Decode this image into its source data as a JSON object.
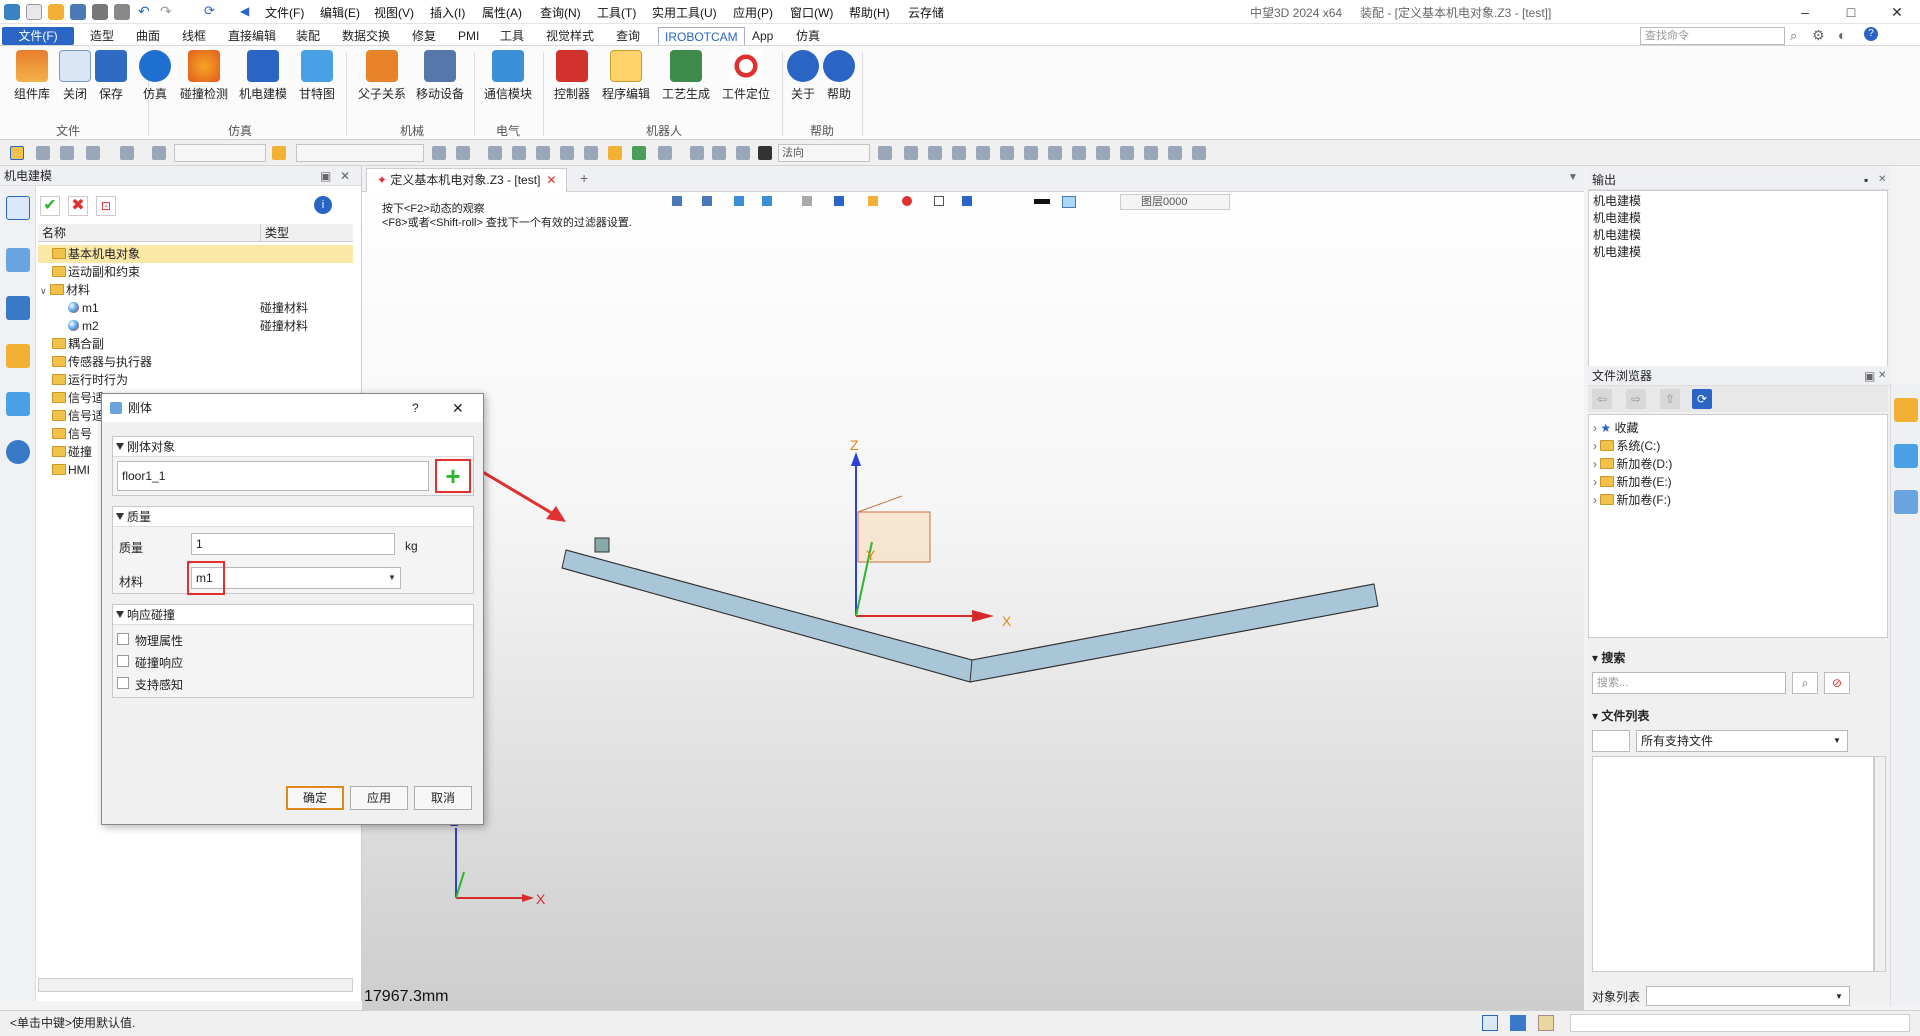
{
  "titlebar": {
    "menus": [
      "文件(F)",
      "编辑(E)",
      "视图(V)",
      "插入(I)",
      "属性(A)",
      "查询(N)",
      "工具(T)",
      "实用工具(U)",
      "应用(P)",
      "窗口(W)",
      "帮助(H)",
      "云存储"
    ],
    "app_name": "中望3D 2024 x64",
    "doc_title": "装配 - [定义基本机电对象.Z3 - [test]]",
    "search_placeholder": "查找命令"
  },
  "ribbon": {
    "tabs": [
      "文件(F)",
      "造型",
      "曲面",
      "线框",
      "直接编辑",
      "装配",
      "数据交换",
      "修复",
      "PMI",
      "工具",
      "视觉样式",
      "查询",
      "IROBOTCAM",
      "App",
      "仿真"
    ],
    "active_tab": "IROBOTCAM",
    "buttons": [
      "组件库",
      "关闭",
      "保存",
      "仿真",
      "碰撞检测",
      "机电建模",
      "甘特图",
      "父子关系",
      "移动设备",
      "通信模块",
      "控制器",
      "程序编辑",
      "工艺生成",
      "工件定位",
      "关于",
      "帮助"
    ],
    "groups": [
      "文件",
      "仿真",
      "机械",
      "电气",
      "机器人",
      "帮助"
    ]
  },
  "toolbar2": {
    "combo_filter": "法向"
  },
  "left_panel": {
    "title": "机电建模",
    "columns": [
      "名称",
      "类型"
    ],
    "tree": [
      {
        "name": "基本机电对象",
        "type": "",
        "kind": "folder",
        "selected": true
      },
      {
        "name": "运动副和约束",
        "type": "",
        "kind": "folder"
      },
      {
        "name": "材料",
        "type": "",
        "kind": "folder",
        "expanded": true
      },
      {
        "name": "m1",
        "type": "碰撞材料",
        "kind": "material"
      },
      {
        "name": "m2",
        "type": "碰撞材料",
        "kind": "material"
      },
      {
        "name": "耦合副",
        "type": "",
        "kind": "folder"
      },
      {
        "name": "传感器与执行器",
        "type": "",
        "kind": "folder"
      },
      {
        "name": "运行时行为",
        "type": "",
        "kind": "folder"
      },
      {
        "name": "信号适",
        "type": "",
        "kind": "folder"
      },
      {
        "name": "信号适",
        "type": "",
        "kind": "folder"
      },
      {
        "name": "信号",
        "type": "",
        "kind": "folder"
      },
      {
        "name": "碰撞",
        "type": "",
        "kind": "folder"
      },
      {
        "name": "HMI",
        "type": "",
        "kind": "folder"
      }
    ]
  },
  "viewport": {
    "tab_title": "定义基本机电对象.Z3 - [test]",
    "hint_line1": "按下<F2>动态的观察",
    "hint_line2": "<F8>或者<Shift-roll> 查找下一个有效的过滤器设置.",
    "layer": "图层0000",
    "distance": "17967.3mm",
    "axis_x": "X",
    "axis_y": "Y",
    "axis_z": "Z"
  },
  "dialog": {
    "title": "刚体",
    "help": "?",
    "close": "✕",
    "section_rigid": "刚体对象",
    "rigid_value": "floor1_1",
    "section_mass": "质量",
    "mass_label": "质量",
    "mass_value": "1",
    "mass_unit": "kg",
    "material_label": "材料",
    "material_value": "m1",
    "section_collision": "响应碰撞",
    "checks": [
      "物理属性",
      "碰撞响应",
      "支持感知"
    ],
    "ok": "确定",
    "apply": "应用",
    "cancel": "取消"
  },
  "output_panel": {
    "title": "输出",
    "lines": [
      "机电建模",
      "机电建模",
      "机电建模",
      "机电建模"
    ]
  },
  "file_browser": {
    "title": "文件浏览器",
    "items": [
      "收藏",
      "系统(C:)",
      "新加卷(D:)",
      "新加卷(E:)",
      "新加卷(F:)"
    ],
    "search_title": "搜索",
    "search_placeholder": "搜索...",
    "filelist_title": "文件列表",
    "filter_value": "所有支持文件",
    "objlist_label": "对象列表"
  },
  "status": {
    "text": "<单击中键>使用默认值."
  },
  "colors": {
    "accent": "#2a65c6",
    "highlight_red": "#e03030",
    "plus_green": "#2db52d",
    "beam_fill": "#a9c6d8"
  }
}
